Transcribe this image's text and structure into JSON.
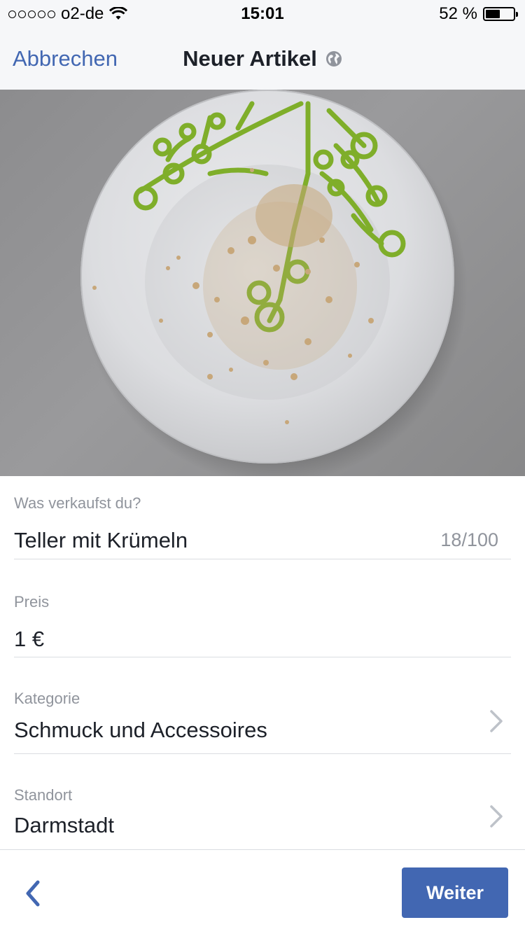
{
  "status_bar": {
    "carrier": "o2-de",
    "time": "15:01",
    "battery": "52 %",
    "battery_level": 0.52
  },
  "nav": {
    "cancel_label": "Abbrechen",
    "title": "Neuer Artikel",
    "title_icon": "globe-icon"
  },
  "photo": {
    "subject": "white plate with green branch pattern and crumbs on grey background"
  },
  "form": {
    "what": {
      "label": "Was verkaufst du?",
      "value": "Teller mit Krümeln",
      "counter": "18/100"
    },
    "price": {
      "label": "Preis",
      "value": "1 €"
    },
    "category": {
      "label": "Kategorie",
      "value": "Schmuck und Accessoires"
    },
    "location": {
      "label": "Standort",
      "value": "Darmstadt"
    }
  },
  "footer": {
    "next_label": "Weiter"
  },
  "colors": {
    "accent": "#4267b2",
    "secondary_text": "#90949c",
    "divider": "#dadde1"
  }
}
